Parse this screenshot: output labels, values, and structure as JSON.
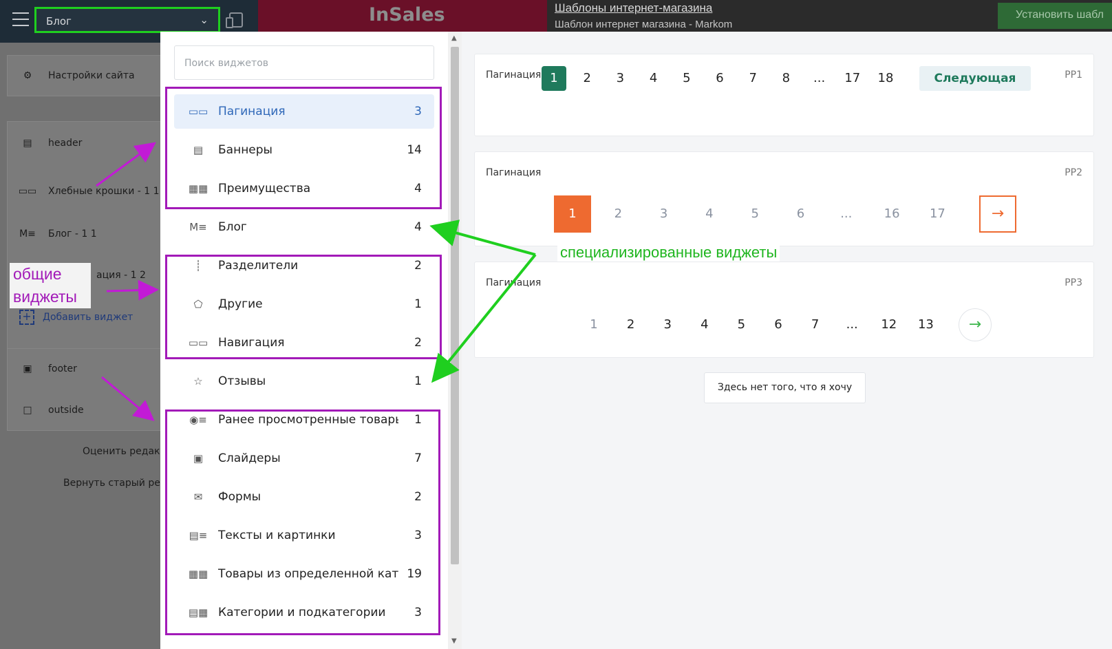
{
  "topbar": {
    "page_select": "Блог",
    "logo": "InSales",
    "title": "Шаблоны интернет-магазина",
    "subtitle": "Шаблон интернет магазина - Markom",
    "install_button": "Установить шабл"
  },
  "sidebar": {
    "site_settings": "Настройки сайта",
    "items": [
      {
        "label": "header",
        "icon": "header-icon"
      },
      {
        "label": "Хлебные крошки - 1 1",
        "icon": "breadcrumbs-icon"
      },
      {
        "label": "Блог - 1 1",
        "icon": "blog-icon"
      },
      {
        "label": "ация - 1 2",
        "icon": "pagination-icon"
      }
    ],
    "add_widget": "Добавить виджет",
    "footer_items": [
      {
        "label": "footer",
        "icon": "footer-icon"
      },
      {
        "label": "outside",
        "icon": "outside-icon"
      }
    ],
    "rate_editor": "Оценить редакт",
    "return_old_editor": "Вернуть старый ред"
  },
  "annotations": {
    "general_widgets": [
      "общие",
      "виджеты"
    ],
    "specialized_widgets": "специализированные виджеты"
  },
  "widget_panel": {
    "search_placeholder": "Поиск виджетов",
    "categories": [
      {
        "name": "Пагинация",
        "count": "3",
        "icon": "pagination-icon",
        "active": true
      },
      {
        "name": "Баннеры",
        "count": "14",
        "icon": "banner-icon"
      },
      {
        "name": "Преимущества",
        "count": "4",
        "icon": "advantages-icon"
      },
      {
        "name": "Блог",
        "count": "4",
        "icon": "blog-icon"
      },
      {
        "name": "Разделители",
        "count": "2",
        "icon": "divider-icon"
      },
      {
        "name": "Другие",
        "count": "1",
        "icon": "other-icon"
      },
      {
        "name": "Навигация",
        "count": "2",
        "icon": "navigation-icon"
      },
      {
        "name": "Отзывы",
        "count": "1",
        "icon": "reviews-icon"
      },
      {
        "name": "Ранее просмотренные товары",
        "count": "1",
        "icon": "viewed-products-icon"
      },
      {
        "name": "Слайдеры",
        "count": "7",
        "icon": "slider-icon"
      },
      {
        "name": "Формы",
        "count": "2",
        "icon": "form-icon"
      },
      {
        "name": "Тексты и картинки",
        "count": "3",
        "icon": "text-image-icon"
      },
      {
        "name": "Товары из определенной кате...",
        "count": "19",
        "icon": "category-products-icon"
      },
      {
        "name": "Категории и подкатегории",
        "count": "3",
        "icon": "categories-icon"
      }
    ]
  },
  "preview": {
    "cards": [
      {
        "title": "Пагинация",
        "code": "PP1"
      },
      {
        "title": "Пагинация",
        "code": "PP2"
      },
      {
        "title": "Пагинация",
        "code": "PP3"
      }
    ],
    "pp1_pages": [
      "1",
      "2",
      "3",
      "4",
      "5",
      "6",
      "7",
      "8",
      "...",
      "17",
      "18"
    ],
    "pp1_next": "Следующая",
    "pp2_pages": [
      "1",
      "2",
      "3",
      "4",
      "5",
      "6",
      "...",
      "16",
      "17"
    ],
    "pp2_next": "→",
    "pp3_pages": [
      "1",
      "2",
      "3",
      "4",
      "5",
      "6",
      "7",
      "...",
      "12",
      "13"
    ],
    "pp3_next": "→",
    "nothing_button": "Здесь нет того, что я хочу"
  },
  "colors": {
    "annotation_purple": "#a21ab8",
    "annotation_green": "#1fcf1f",
    "pp1_accent": "#1f7a5c",
    "pp2_accent": "#ee6a30",
    "pp3_accent": "#3cb64b"
  }
}
